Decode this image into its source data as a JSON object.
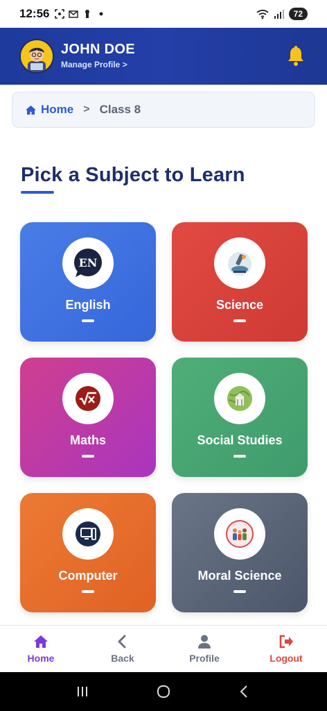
{
  "status_bar": {
    "time": "12:56",
    "battery": "72"
  },
  "header": {
    "user_name": "JOHN DOE",
    "manage_profile": "Manage Profile >"
  },
  "breadcrumb": {
    "home": "Home",
    "separator": ">",
    "current": "Class 8"
  },
  "page_title": "Pick a Subject to Learn",
  "subjects": [
    {
      "label": "English",
      "color": "#3f73e2",
      "icon": "en-speech-bubble-icon",
      "icon_text": "EN"
    },
    {
      "label": "Science",
      "color": "#d9413b",
      "icon": "microscope-icon"
    },
    {
      "label": "Maths",
      "color": "#bd3aa8",
      "icon": "square-root-icon"
    },
    {
      "label": "Social Studies",
      "color": "#47a572",
      "icon": "globe-landmark-icon"
    },
    {
      "label": "Computer",
      "color": "#e66d2b",
      "icon": "computer-monitor-icon"
    },
    {
      "label": "Moral Science",
      "color": "#5b6578",
      "icon": "family-values-icon"
    }
  ],
  "bottom_nav": [
    {
      "label": "Home",
      "icon": "home-icon",
      "color": "#7c3ad8"
    },
    {
      "label": "Back",
      "icon": "chevron-left-icon",
      "color": "#6b7280"
    },
    {
      "label": "Profile",
      "icon": "user-icon",
      "color": "#6b7280"
    },
    {
      "label": "Logout",
      "icon": "logout-icon",
      "color": "#e0453a"
    }
  ]
}
